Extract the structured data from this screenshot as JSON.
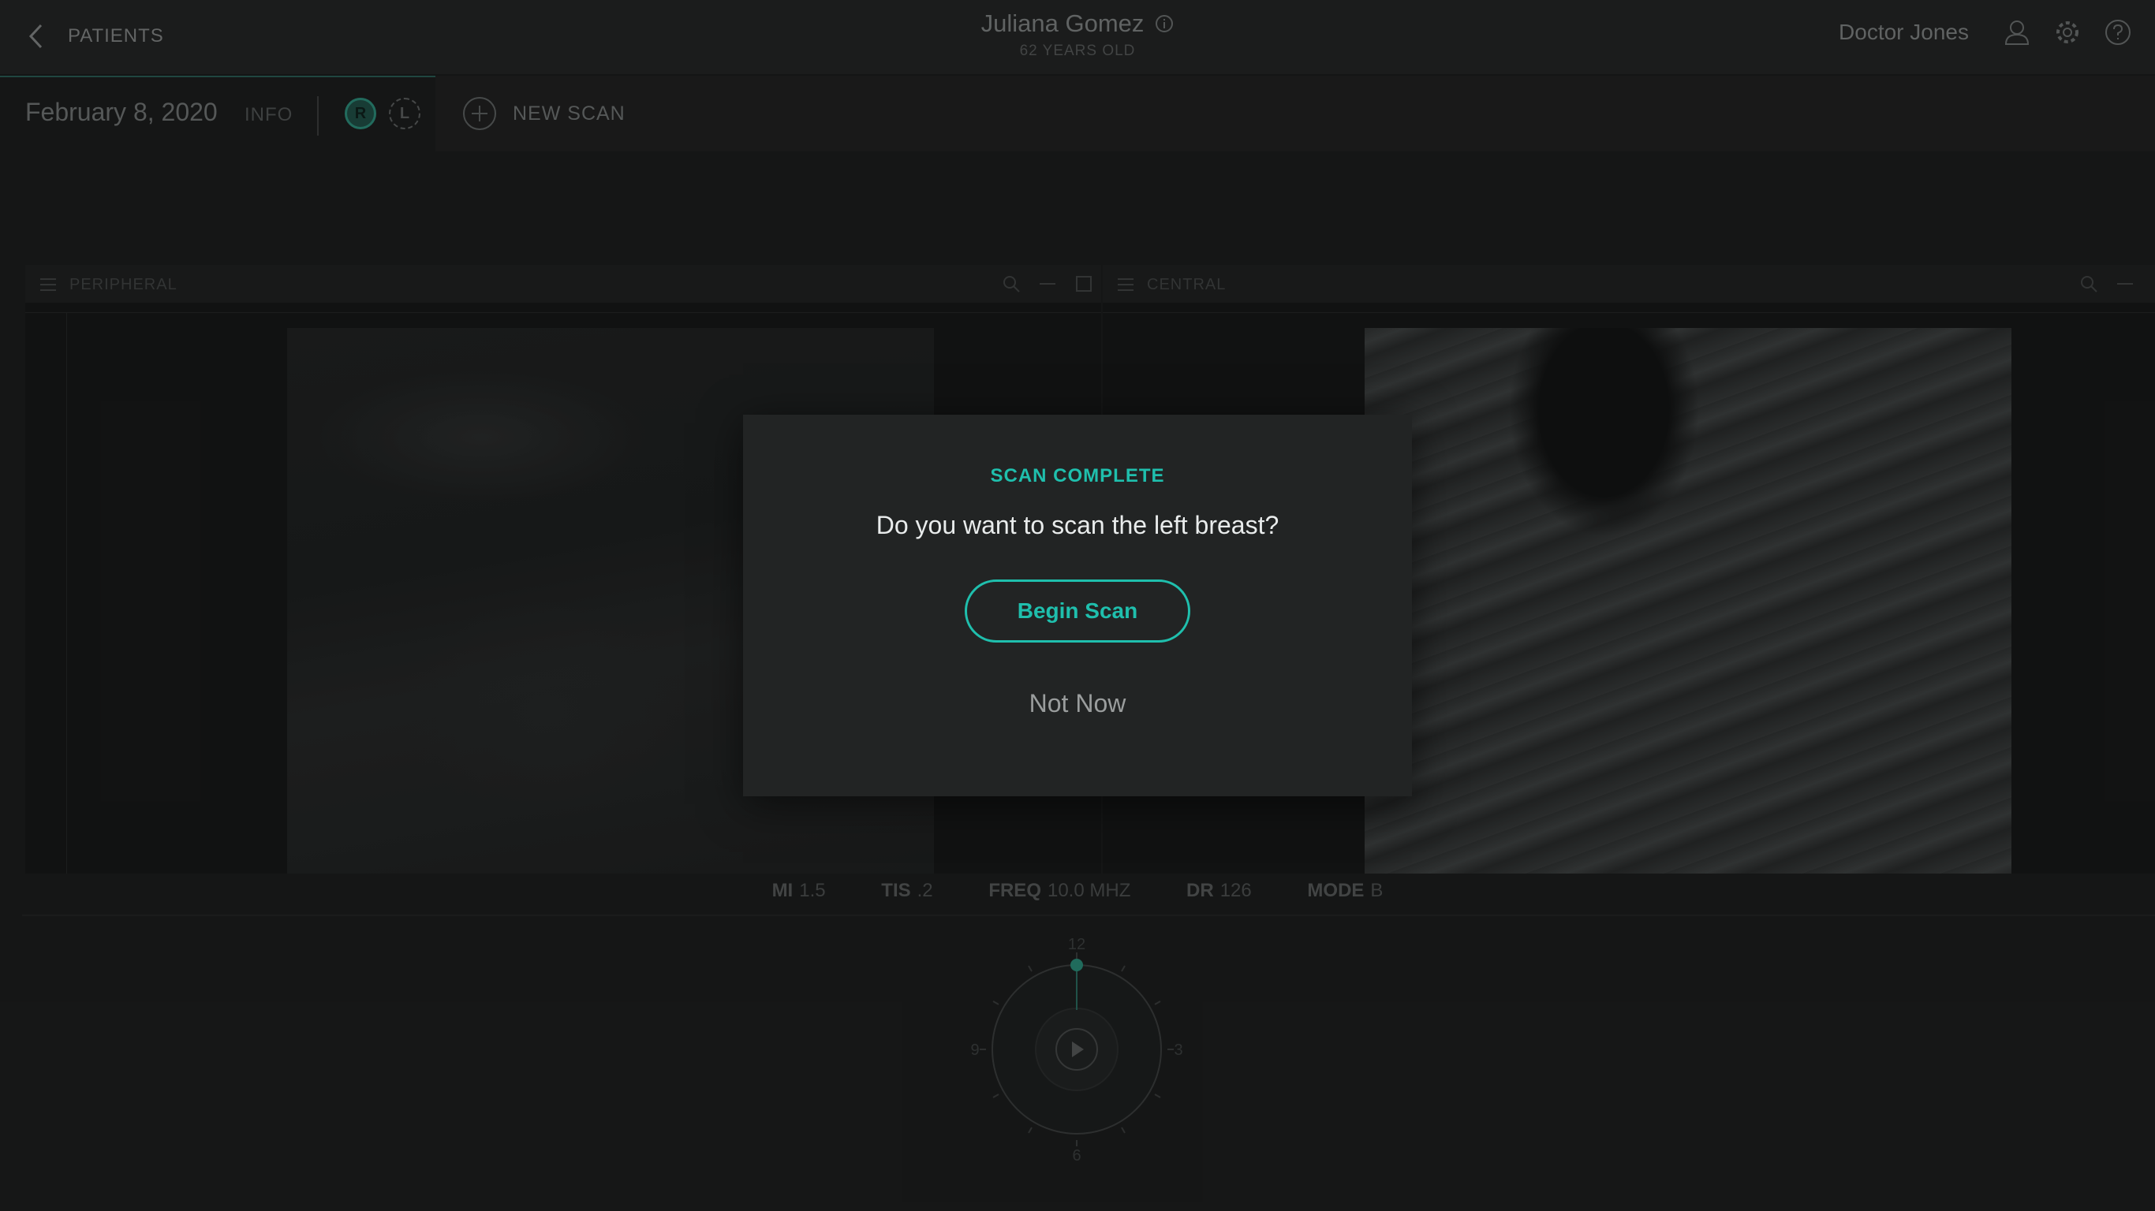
{
  "header": {
    "back_label": "PATIENTS",
    "patient_name": "Juliana Gomez",
    "patient_age": "62 YEARS OLD",
    "user_name": "Doctor Jones",
    "icons": [
      "chevron-left-icon",
      "info-icon",
      "user-icon",
      "gear-icon",
      "help-icon"
    ]
  },
  "session": {
    "date": "February 8, 2020",
    "info_label": "INFO",
    "side_right": "R",
    "side_left": "L",
    "new_scan_label": "NEW SCAN"
  },
  "panels": [
    {
      "title": "PERIPHERAL"
    },
    {
      "title": "CENTRAL"
    }
  ],
  "params": {
    "mi": {
      "label": "MI",
      "value": "1.5"
    },
    "tis": {
      "label": "TIS",
      "value": ".2"
    },
    "freq": {
      "label": "FREQ",
      "value": "10.0 MHZ"
    },
    "dr": {
      "label": "DR",
      "value": "126"
    },
    "mode": {
      "label": "MODE",
      "value": "B"
    }
  },
  "dial": {
    "top": "12",
    "right": "3",
    "bottom": "6",
    "left": "9"
  },
  "modal": {
    "title": "SCAN COMPLETE",
    "question": "Do you want to scan the left breast?",
    "primary_button": "Begin Scan",
    "secondary_button": "Not Now"
  },
  "colors": {
    "accent": "#1fbfad",
    "background": "#1c1d1d",
    "modal": "#222424"
  }
}
